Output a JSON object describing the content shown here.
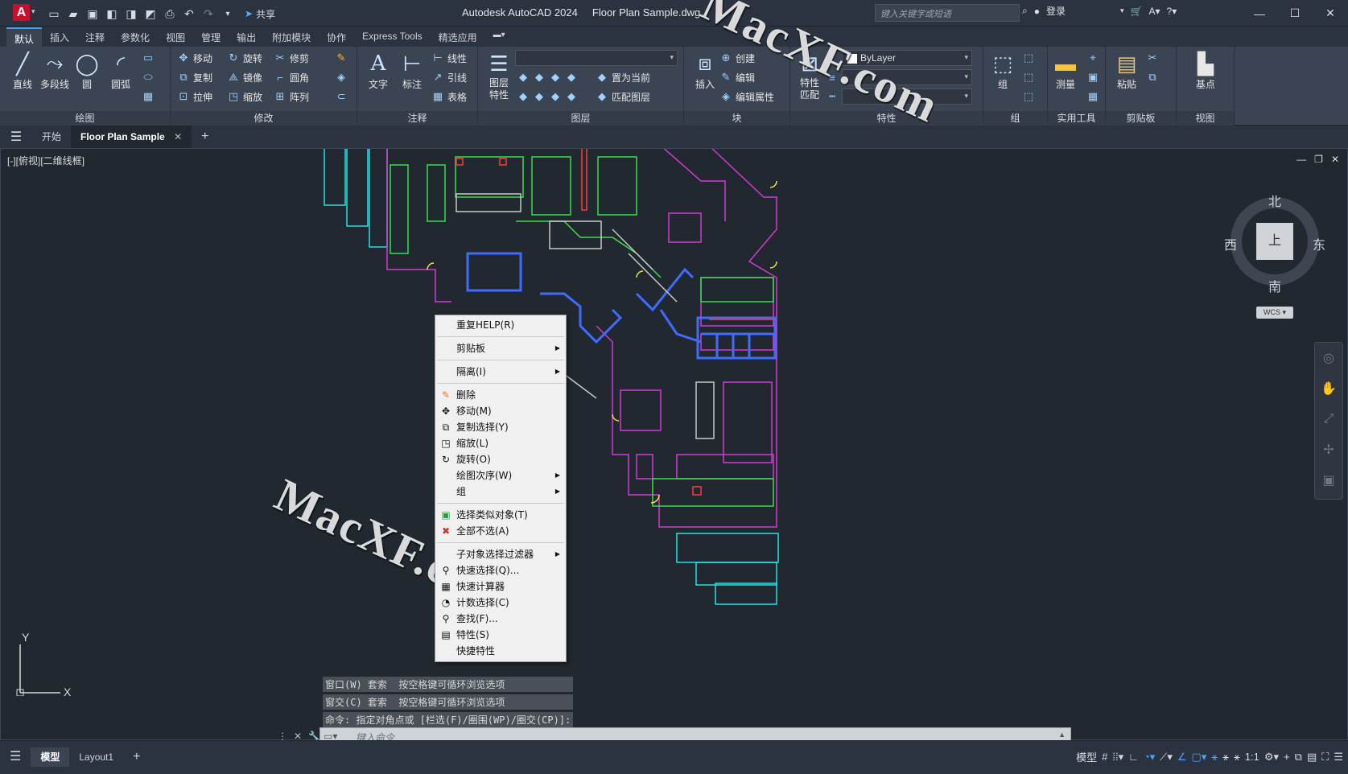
{
  "app": {
    "title": "Autodesk AutoCAD 2024",
    "file": "Floor Plan Sample.dwg",
    "logo_letter": "A",
    "share_label": "共享",
    "search_placeholder": "键入关键字或短语",
    "login_label": "登录"
  },
  "ribbon_tabs": [
    "默认",
    "插入",
    "注释",
    "参数化",
    "视图",
    "管理",
    "输出",
    "附加模块",
    "协作",
    "Express Tools",
    "精选应用"
  ],
  "panels": {
    "draw": {
      "label": "绘图",
      "line": "直线",
      "polyline": "多段线",
      "circle": "圆",
      "arc": "圆弧"
    },
    "modify": {
      "label": "修改",
      "move": "移动",
      "rotate": "旋转",
      "trim": "修剪",
      "copy": "复制",
      "mirror": "镜像",
      "fillet": "圆角",
      "stretch": "拉伸",
      "scale": "缩放",
      "array": "阵列"
    },
    "annotation": {
      "label": "注释",
      "text": "文字",
      "dimension": "标注",
      "linear": "线性",
      "leader": "引线",
      "table": "表格"
    },
    "layers": {
      "label": "图层",
      "layer_props": "图层特性",
      "make_current": "置为当前",
      "match_layer": "匹配图层"
    },
    "block": {
      "label": "块",
      "insert": "插入",
      "create": "创建",
      "edit": "编辑",
      "edit_attr": "编辑属性"
    },
    "properties": {
      "label": "特性",
      "match": "特性匹配",
      "bylayer": "ByLayer"
    },
    "groups": {
      "label": "组",
      "group": "组"
    },
    "utilities": {
      "label": "实用工具",
      "measure": "测量"
    },
    "clipboard": {
      "label": "剪贴板",
      "paste": "粘贴"
    },
    "view": {
      "label": "视图",
      "base": "基点"
    }
  },
  "doc_tabs": {
    "start": "开始",
    "active": "Floor Plan Sample"
  },
  "viewport": {
    "label": "[-][俯视][二维线框]"
  },
  "viewcube": {
    "north": "北",
    "south": "南",
    "east": "东",
    "west": "西",
    "top": "上",
    "wcs": "WCS"
  },
  "context_menu": {
    "repeat_help": "重复HELP(R)",
    "clipboard": "剪贴板",
    "isolate": "隔离(I)",
    "erase": "删除",
    "move": "移动(M)",
    "copy_select": "复制选择(Y)",
    "scale": "缩放(L)",
    "rotate": "旋转(O)",
    "draw_order": "绘图次序(W)",
    "group": "组",
    "select_similar": "选择类似对象(T)",
    "deselect_all": "全部不选(A)",
    "subobject_filter": "子对象选择过滤器",
    "quick_select": "快速选择(Q)...",
    "quick_calc": "快速计算器",
    "count_select": "计数选择(C)",
    "find": "查找(F)...",
    "properties": "特性(S)",
    "quick_props": "快捷特性"
  },
  "command": {
    "history": [
      "窗口(W) 套索  按空格键可循环浏览选项",
      "窗交(C) 套索  按空格键可循环浏览选项",
      "命令: 指定对角点或 [栏选(F)/圈围(WP)/圈交(CP)]:"
    ],
    "placeholder": "键入命令"
  },
  "status": {
    "model_tab": "模型",
    "layout_tab": "Layout1",
    "model_label": "模型",
    "scale": "1:1"
  },
  "axis": {
    "x": "X",
    "y": "Y"
  },
  "watermark": "MacXF.com",
  "colors": {
    "accent": "#4a9fe6",
    "brand": "#c8102e"
  }
}
